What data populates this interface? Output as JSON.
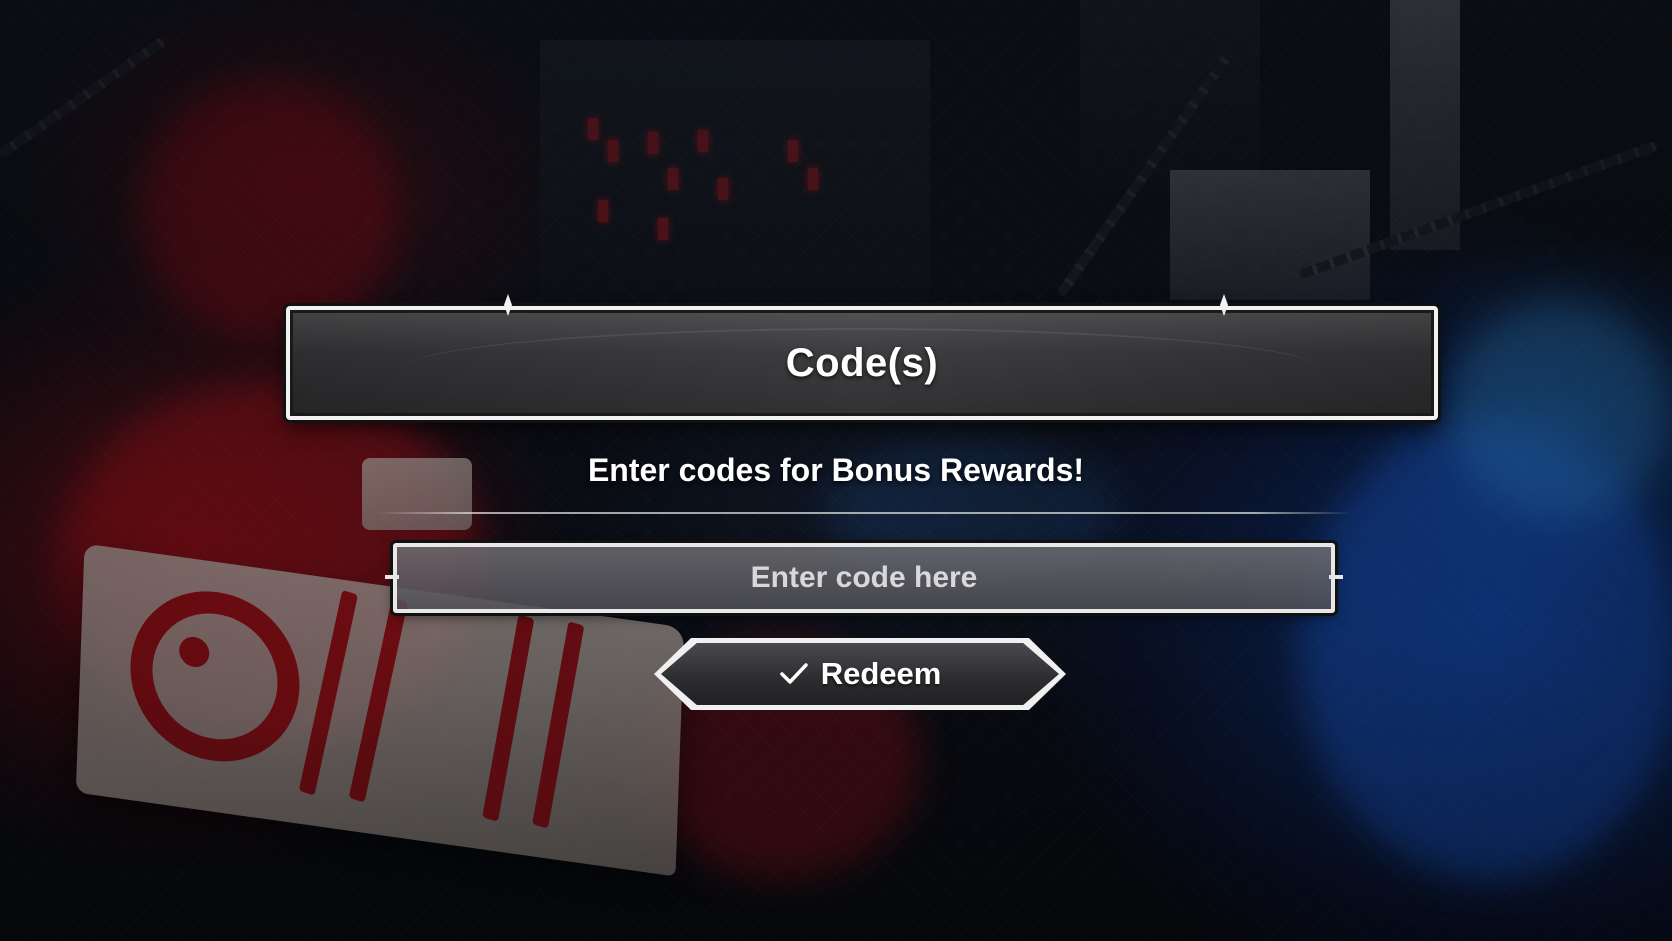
{
  "panel": {
    "title": "Code(s)",
    "subtitle": "Enter codes for Bonus Rewards!"
  },
  "code_input": {
    "value": "",
    "placeholder": "Enter code here"
  },
  "redeem_button": {
    "icon": "check-icon",
    "label": "Redeem"
  },
  "colors": {
    "panel_dark": "#2a2a2c",
    "border_white": "#f2f2f2",
    "left_flame": "#c8141e",
    "right_flame": "#145ae6"
  }
}
